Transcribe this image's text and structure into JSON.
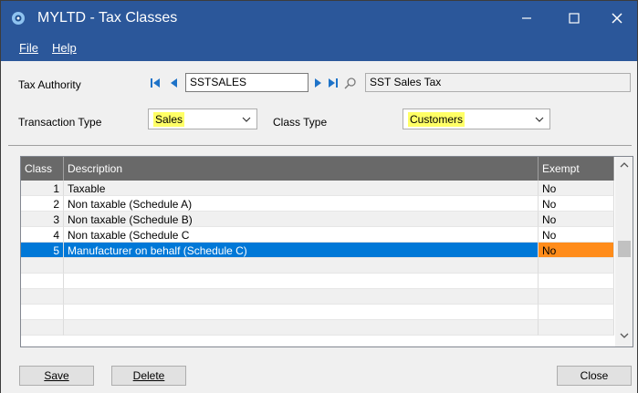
{
  "window": {
    "title": "MYLTD - Tax Classes"
  },
  "menu": {
    "file": "File",
    "help": "Help"
  },
  "form": {
    "tax_authority_label": "Tax Authority",
    "tax_authority_value": "SSTSALES",
    "tax_authority_desc": "SST Sales Tax",
    "transaction_type_label": "Transaction Type",
    "transaction_type_value": "Sales",
    "class_type_label": "Class Type",
    "class_type_value": "Customers"
  },
  "grid": {
    "columns": [
      "Class",
      "Description",
      "Exempt"
    ],
    "rows": [
      {
        "class": "1",
        "description": "Taxable",
        "exempt": "No"
      },
      {
        "class": "2",
        "description": "Non taxable (Schedule A)",
        "exempt": "No"
      },
      {
        "class": "3",
        "description": "Non taxable (Schedule B)",
        "exempt": "No"
      },
      {
        "class": "4",
        "description": "Non taxable (Schedule C",
        "exempt": "No"
      },
      {
        "class": "5",
        "description": "Manufacturer on behalf (Schedule C)",
        "exempt": "No"
      }
    ],
    "selected_row": 5
  },
  "buttons": {
    "save": "Save",
    "delete": "Delete",
    "close": "Close"
  },
  "colors": {
    "titlebar": "#2b579a",
    "selection": "#0078d7",
    "exempt_highlight": "#ff8c1a",
    "field_highlight": "#ffff66"
  }
}
